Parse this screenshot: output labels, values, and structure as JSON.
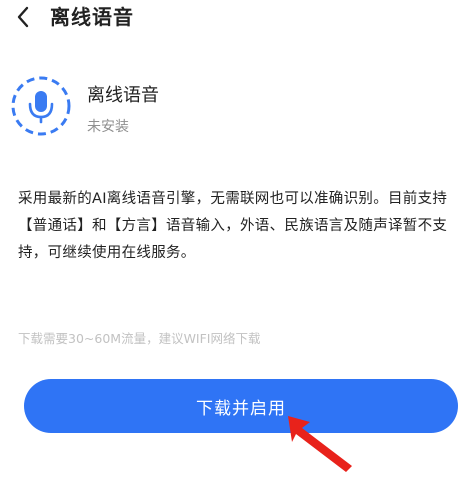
{
  "header": {
    "title": "离线语音",
    "back_icon": "chevron-left-icon"
  },
  "app": {
    "icon": "microphone-icon",
    "icon_color": "#3a7bf2",
    "name": "离线语音",
    "status": "未安装"
  },
  "description": "采用最新的AI离线语音引擎，无需联网也可以准确识别。目前支持【普通话】和【方言】语音输入，外语、民族语言及随声译暂不支持，可继续使用在线服务。",
  "notice": "下载需要30~60M流量，建议WIFI网络下载",
  "download_button": {
    "label": "下载并启用",
    "color": "#2f74f5"
  },
  "annotation": {
    "arrow_color": "#e8221b"
  }
}
